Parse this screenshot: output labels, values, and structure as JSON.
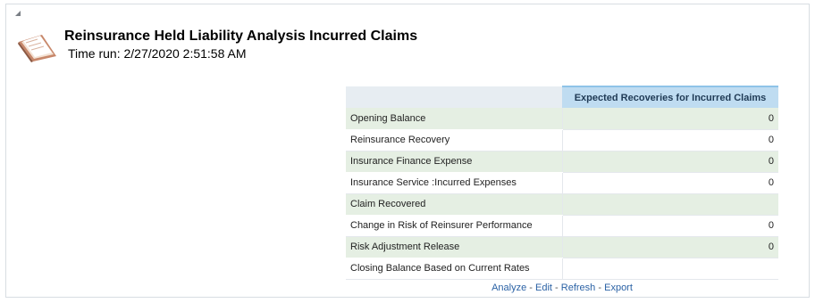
{
  "report": {
    "title": "Reinsurance Held Liability Analysis Incurred Claims",
    "time_run_label": "Time run:",
    "time_run_value": "2/27/2020 2:51:58 AM"
  },
  "table": {
    "column_header": "Expected Recoveries for Incurred Claims",
    "rows": [
      {
        "label": "Opening Balance",
        "value": "0"
      },
      {
        "label": "Reinsurance Recovery",
        "value": "0"
      },
      {
        "label": "Insurance Finance Expense",
        "value": "0"
      },
      {
        "label": "Insurance Service :Incurred Expenses",
        "value": "0"
      },
      {
        "label": "Claim Recovered",
        "value": ""
      },
      {
        "label": "Change in Risk of Reinsurer Performance",
        "value": "0"
      },
      {
        "label": "Risk Adjustment Release",
        "value": "0"
      },
      {
        "label": "Closing Balance Based on Current Rates",
        "value": ""
      }
    ]
  },
  "footer": {
    "analyze": "Analyze",
    "edit": "Edit",
    "refresh": "Refresh",
    "export": "Export",
    "separator": "-"
  },
  "icons": {
    "collapse": "collapse-triangle-icon",
    "report": "report-book-icon"
  },
  "colors": {
    "header_bg": "#bfdcf1",
    "row_shaded": "#e5efe3",
    "link": "#2b62a5"
  }
}
